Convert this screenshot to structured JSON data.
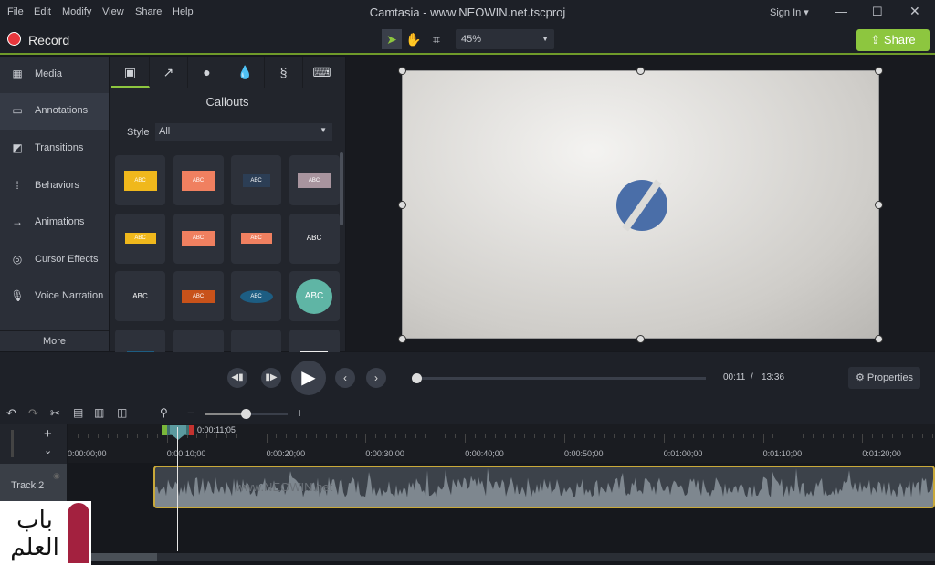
{
  "menu": [
    "File",
    "Edit",
    "Modify",
    "View",
    "Share",
    "Help"
  ],
  "window_title": "Camtasia - www.NEOWIN.net.tscproj",
  "sign_in": "Sign In ▾",
  "record_label": "Record",
  "zoom_level": "45%",
  "share_label": "Share",
  "accent_color": "#8dc63f",
  "sidebar": {
    "items": [
      "Media",
      "Annotations",
      "Transitions",
      "Behaviors",
      "Animations",
      "Cursor Effects",
      "Voice Narration"
    ],
    "more": "More",
    "selected": "Annotations"
  },
  "panel": {
    "title": "Callouts",
    "style_label": "Style",
    "style_value": "All",
    "tile_text": "ABC"
  },
  "playback": {
    "current": "00:11",
    "separator": "/",
    "total": "13:36",
    "properties": "Properties",
    "progress_percent": 1.4
  },
  "timeline": {
    "playhead_time": "0:00:11;05",
    "ruler": [
      "0:00:00;00",
      "0:00:10;00",
      "0:00:20;00",
      "0:00:30;00",
      "0:00:40;00",
      "0:00:50;00",
      "0:01:00;00",
      "0:01:10;00",
      "0:01:20;00"
    ],
    "track_label": "Track 2",
    "clip_watermark": "www.NEOWIN.net"
  },
  "watermark_logo": "باب العلم"
}
